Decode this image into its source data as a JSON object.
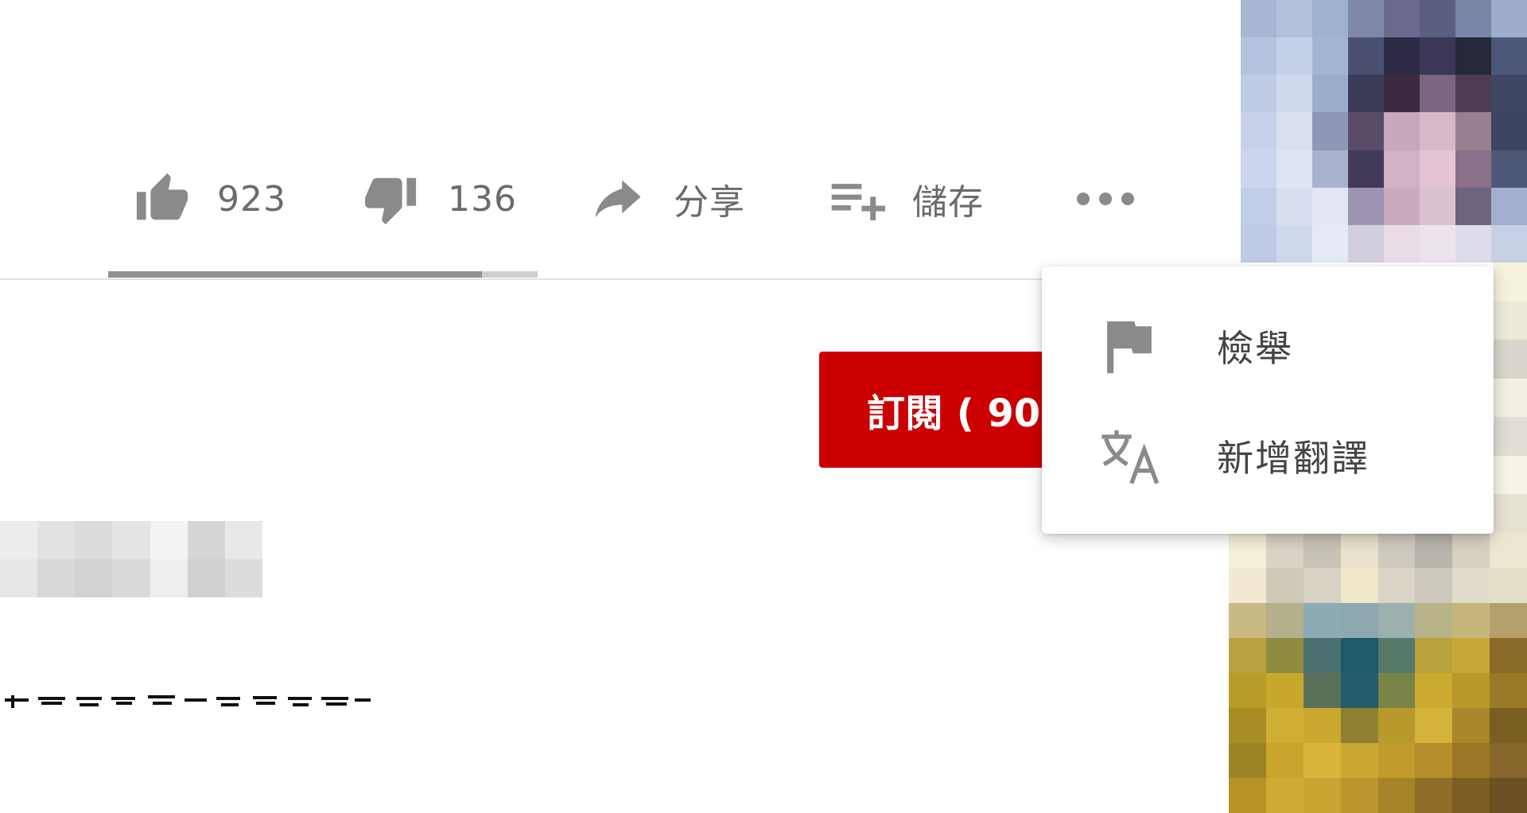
{
  "actions": {
    "like_count": "923",
    "dislike_count": "136",
    "share_label": "分享",
    "save_label": "儲存",
    "more_icon": "more-horiz-icon"
  },
  "sentiment": {
    "like_fraction": 0.87
  },
  "subscribe": {
    "label": "訂閱 ( 90"
  },
  "menu": {
    "items": [
      {
        "label": "檢舉",
        "icon": "flag-icon"
      },
      {
        "label": "新增翻譯",
        "icon": "translate-icon"
      }
    ]
  },
  "colors": {
    "subscribe_red": "#cc0000",
    "icon_gray": "#888888",
    "text_gray": "#666666"
  }
}
